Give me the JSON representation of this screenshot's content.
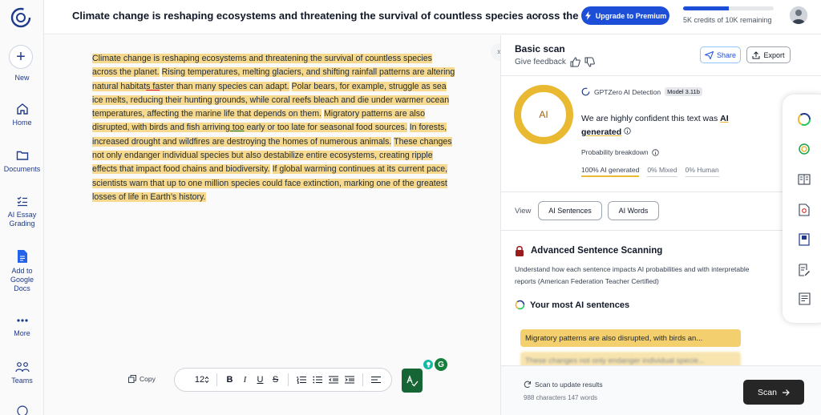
{
  "header": {
    "doc_title": "Climate change is reshaping ecosystems and threatening the survival of countless species across the",
    "upgrade_label": "Upgrade to Premium",
    "credits_text": "5K credits of 10K remaining",
    "credits_fraction": 0.5
  },
  "sidebar": {
    "new_label": "New",
    "items": [
      {
        "label": "Home",
        "icon": "home-icon"
      },
      {
        "label": "Documents",
        "icon": "folder-icon"
      },
      {
        "label": "AI Essay Grading",
        "icon": "checklist-icon"
      },
      {
        "label": "Add to Google Docs",
        "icon": "docs-icon"
      },
      {
        "label": "More",
        "icon": "more-icon"
      },
      {
        "label": "Teams",
        "icon": "teams-icon"
      }
    ]
  },
  "editor": {
    "s1": "Climate change is reshaping ecosystems and threatening the survival of countless species across the planet.",
    "s2a": "Rising temperatures, melting glaciers, and shifting rainfall patterns are altering natural habitat",
    "s2b": "s fa",
    "s2c": "ster than many species can adapt.",
    "s3": "Polar bears, for example, struggle as sea ice melts, reducing their hunting grounds, while coral reefs bleach and die under warmer ocean temperatures, affecting the marine life that depends on them.",
    "s4a": "Migratory patterns are also disrupted, with birds and fish arriving",
    "s4b": " too",
    "s4c": " early or too late for seasonal food sources.",
    "s5": "In forests, increased drought and wildfires are destroying the homes of numerous animals.",
    "s6": "These changes not only endanger individual species but also destabilize entire ecosystems, creating ripple effects that impact food chains and biodiversity.",
    "s7": "If global warming continues at its current pace, scientists warn that up to one million species could face extinction, marking one of the greatest losses of life in Earth’s history.",
    "copy_label": "Copy",
    "font_size": "12"
  },
  "panel": {
    "scan_title": "Basic scan",
    "feedback_label": "Give feedback",
    "share_label": "Share",
    "export_label": "Export",
    "ring_label": "AI",
    "detection_label": "GPTZero AI Detection",
    "model_badge": "Model 3.11b",
    "confidence_prefix": "We are highly confident this text was",
    "confidence_strong": "AI generated",
    "prob_label": "Probability breakdown",
    "prob_ai": "100% AI generated",
    "prob_mixed": "0% Mixed",
    "prob_human": "0% Human",
    "view_label": "View",
    "view_sentences": "AI Sentences",
    "view_words": "AI Words",
    "adv_title": "Advanced Sentence Scanning",
    "adv_desc": "Understand how each sentence impacts AI probabilities and with interpretable reports (American Federation Teacher Certified)",
    "top_title": "Your most AI sentences",
    "sentence1": "Migratory patterns are also disrupted, with birds an...",
    "sentence2": "These changes not only endanger individual specie...",
    "scan_update": "Scan to update results",
    "stats": "988 characters 147 words",
    "scan_label": "Scan"
  },
  "colors": {
    "accent": "#1d4ed8",
    "highlight": "#f6d98c",
    "ai_ring": "#e8b931"
  }
}
